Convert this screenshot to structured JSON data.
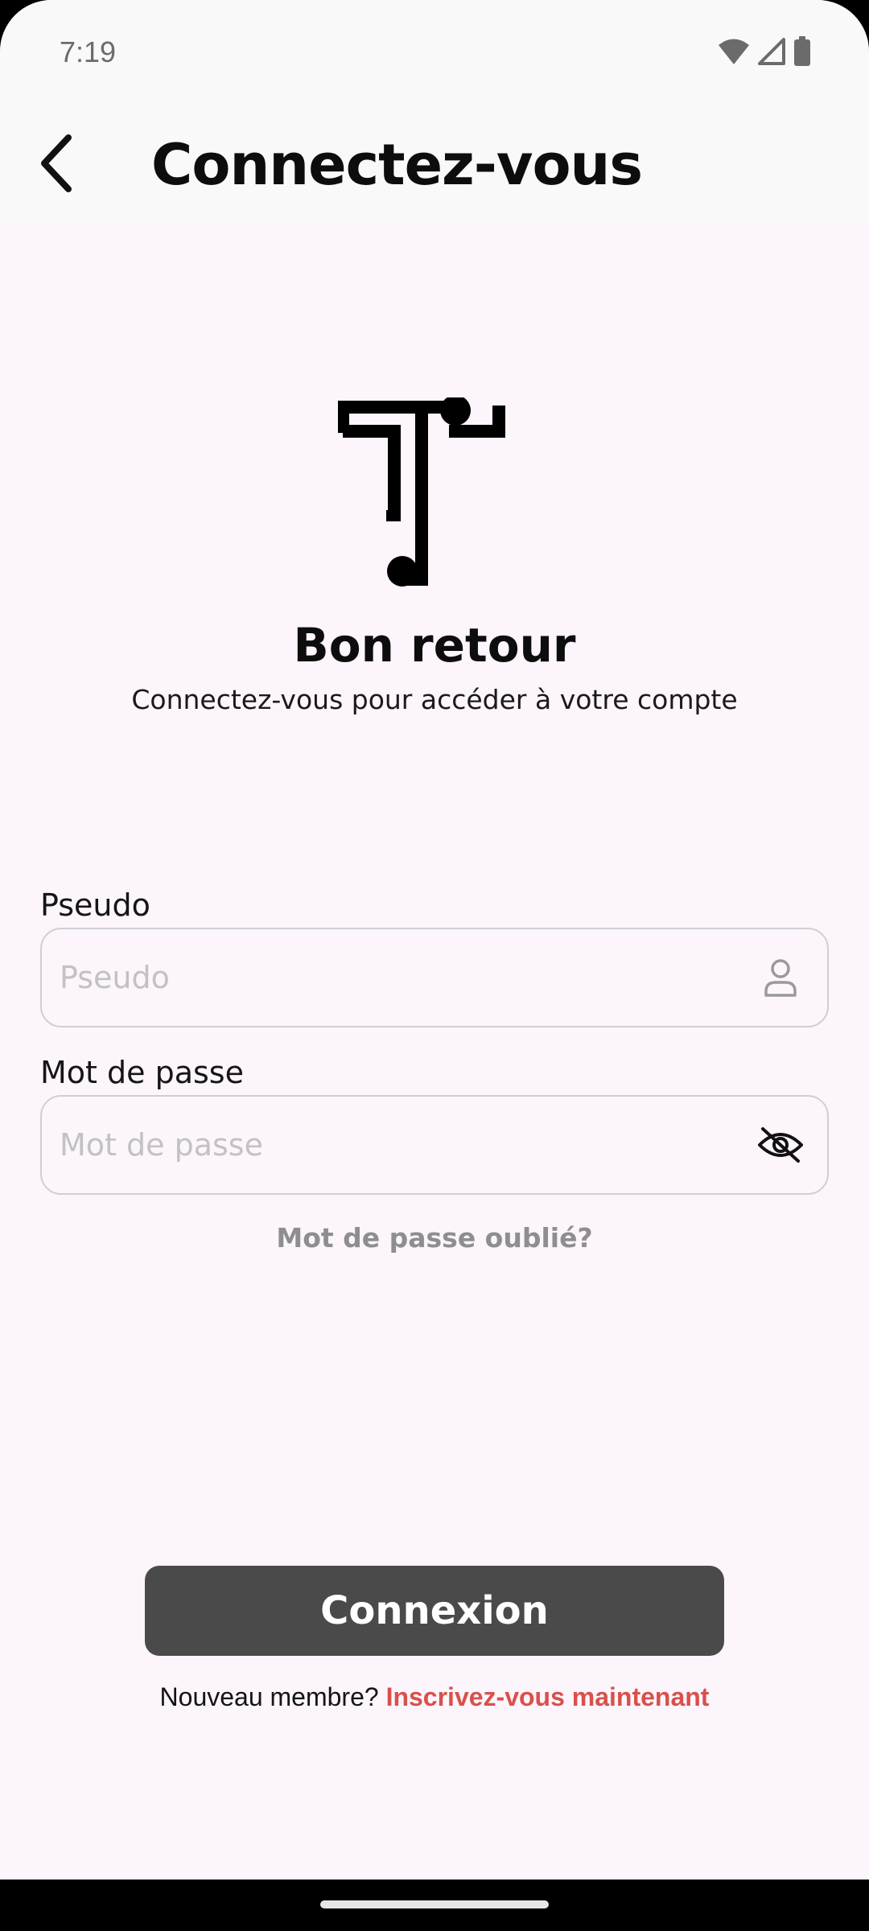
{
  "status_bar": {
    "time": "7:19",
    "icons": [
      "wifi-icon",
      "signal-icon",
      "battery-icon"
    ]
  },
  "header": {
    "back_icon": "chevron-left-icon",
    "title": "Connectez-vous"
  },
  "welcome": {
    "logo_icon": "app-logo-icon",
    "title": "Bon retour",
    "subtitle": "Connectez-vous pour accéder à votre compte"
  },
  "form": {
    "username": {
      "label": "Pseudo",
      "placeholder": "Pseudo",
      "value": "",
      "icon": "user-icon"
    },
    "password": {
      "label": "Mot de passe",
      "placeholder": "Mot de passe",
      "value": "",
      "icon": "eye-off-icon"
    },
    "forgot_password": "Mot de passe oublié?"
  },
  "actions": {
    "login_label": "Connexion",
    "signup_prompt": "Nouveau membre?",
    "signup_link": "Inscrivez-vous maintenant"
  },
  "colors": {
    "background": "#FCF5FC",
    "top_bar": "#F9F9F9",
    "button": "#4A4A4A",
    "accent_link": "#D9504B",
    "muted_text": "#8E8E8E"
  }
}
